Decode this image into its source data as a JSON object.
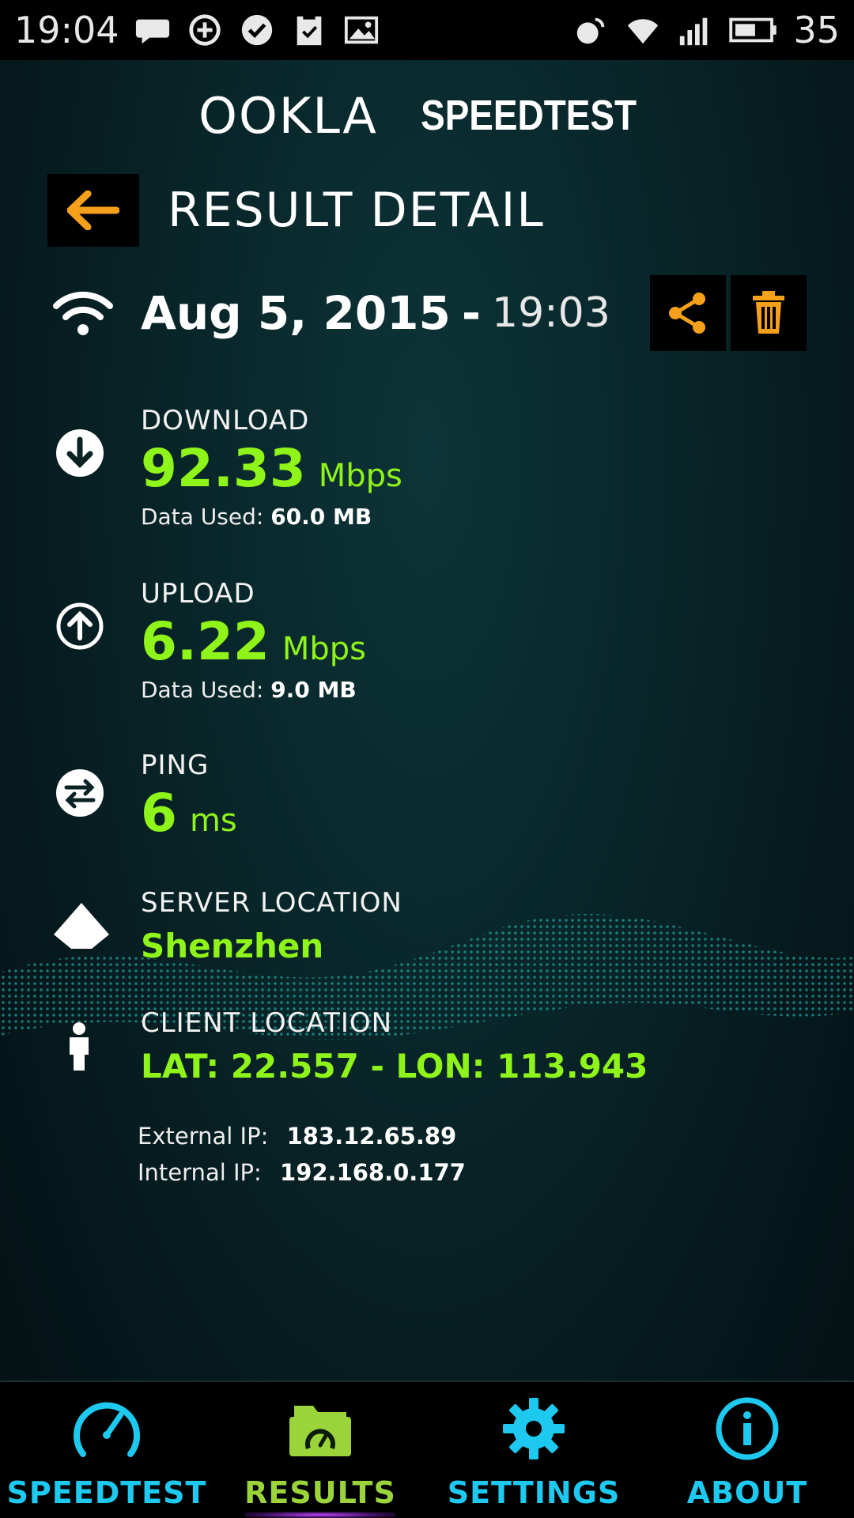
{
  "status_bar": {
    "time": "19:04",
    "battery": "35"
  },
  "logo": {
    "brand": "OOKLA",
    "product": "SPEEDTEST"
  },
  "header": {
    "title": "RESULT DETAIL"
  },
  "result": {
    "date": "Aug 5, 2015",
    "dash": "-",
    "time": "19:03"
  },
  "download": {
    "label": "DOWNLOAD",
    "value": "92.33",
    "unit": "Mbps",
    "data_used_label": "Data Used:",
    "data_used_value": "60.0 MB"
  },
  "upload": {
    "label": "UPLOAD",
    "value": "6.22",
    "unit": "Mbps",
    "data_used_label": "Data Used:",
    "data_used_value": "9.0 MB"
  },
  "ping": {
    "label": "PING",
    "value": "6",
    "unit": "ms"
  },
  "server_location": {
    "label": "SERVER LOCATION",
    "value": "Shenzhen"
  },
  "client_location": {
    "label": "CLIENT LOCATION",
    "value": "LAT: 22.557 - LON: 113.943"
  },
  "ip": {
    "external_label": "External IP:",
    "external_value": "183.12.65.89",
    "internal_label": "Internal IP:",
    "internal_value": "192.168.0.177"
  },
  "nav": {
    "items": [
      {
        "label": "SPEEDTEST",
        "icon": "speedometer-icon",
        "active": false
      },
      {
        "label": "RESULTS",
        "icon": "results-folder-icon",
        "active": true
      },
      {
        "label": "SETTINGS",
        "icon": "gear-icon",
        "active": false
      },
      {
        "label": "ABOUT",
        "icon": "info-icon",
        "active": false
      }
    ]
  },
  "colors": {
    "accent_orange": "#f5a01a",
    "value_green": "#8ef41a",
    "nav_blue": "#1ec9ef",
    "nav_active_green": "#9bd43a"
  }
}
